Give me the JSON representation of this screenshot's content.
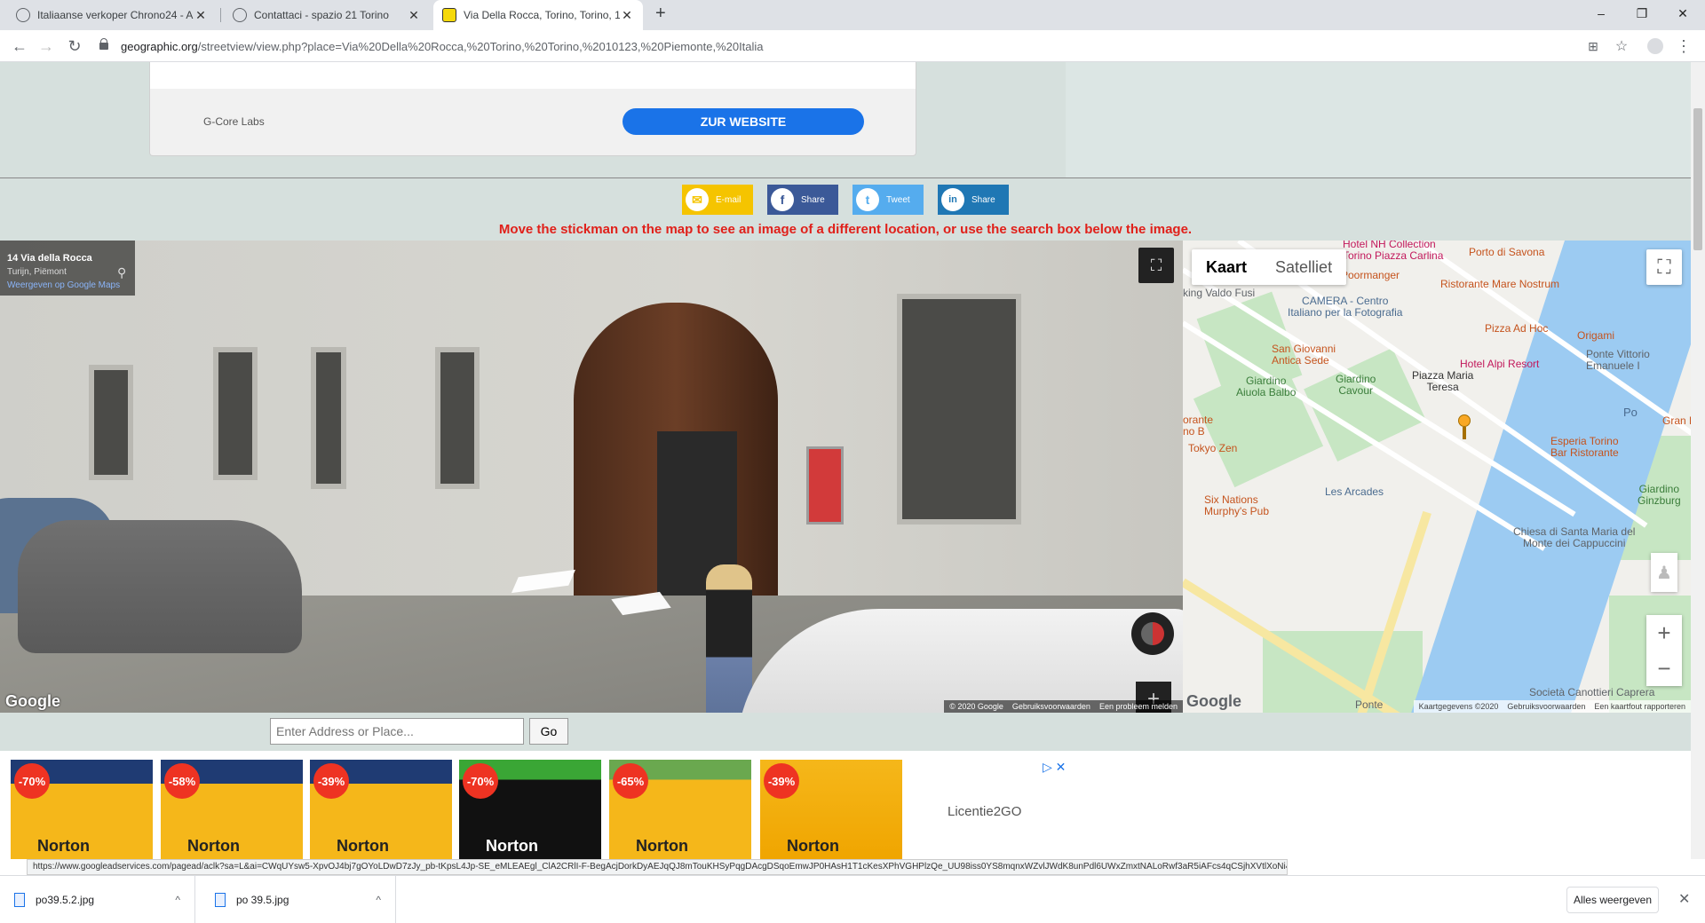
{
  "tabs": [
    {
      "title": "Italiaanse verkoper Chrono24 - A",
      "close": "✕"
    },
    {
      "title": "Contattaci - spazio 21 Torino",
      "close": "✕"
    },
    {
      "title": "Via Della Rocca, Torino, Torino, 10",
      "close": "✕"
    }
  ],
  "window_controls": {
    "minimize": "–",
    "restore": "❐",
    "close": "✕"
  },
  "new_tab": "+",
  "address": {
    "host": "geographic.org",
    "path": "/streetview/view.php?place=Via%20Della%20Rocca,%20Torino,%20Torino,%2010123,%20Piemonte,%20Italia"
  },
  "top_ad": {
    "advertiser": "G-Core Labs",
    "cta": "ZUR WEBSITE"
  },
  "share_buttons": [
    {
      "label": "E-mail",
      "color": "#f5c400",
      "glyph": "✉"
    },
    {
      "label": "Share",
      "color": "#3b5998",
      "glyph": "f"
    },
    {
      "label": "Tweet",
      "color": "#55acee",
      "glyph": "t"
    },
    {
      "label": "Share",
      "color": "#1f77b4",
      "glyph": "in"
    }
  ],
  "instruction": "Move the stickman on the map to see an image of a different location, or use the search box below the image.",
  "streetview": {
    "address": "14 Via della Rocca",
    "city": "Turijn, Piëmont",
    "maps_link": "Weergeven op Google Maps",
    "logo": "Google",
    "footer": [
      "© 2020 Google",
      "Gebruiksvoorwaarden",
      "Een probleem melden"
    ],
    "fullscreen": "⛶",
    "zoom_in": "+",
    "zoom_out": "−"
  },
  "map": {
    "tab_map": "Kaart",
    "tab_satellite": "Satelliet",
    "fullscreen": "⛶",
    "zoom_in": "+",
    "zoom_out": "−",
    "pegman": "♟",
    "logo": "Google",
    "footer": [
      "Kaartgegevens ©2020",
      "Gebruiksvoorwaarden",
      "Een kaartfout rapporteren"
    ],
    "labels": {
      "nh": "Hotel NH Collection\nTorino Piazza Carlina",
      "savona": "Porto di Savona",
      "poormanger": "Poormanger",
      "ristorante": "Ristorante Mare Nostrum",
      "valdo": "king Valdo Fusi",
      "camera": "CAMERA - Centro\nItaliano per la Fotografia",
      "pizza": "Pizza Ad Hoc",
      "origami": "Origami",
      "sangiovanni": "San Giovanni\nAntica Sede",
      "vittorio": "Ponte Vittorio\nEmanuele I",
      "alpi": "Hotel Alpi Resort",
      "aiuola": "Giardino\nAiuola Balbo",
      "cavour": "Giardino\nCavour",
      "teresa": "Piazza Maria\nTeresa",
      "po": "Po",
      "granbe": "Gran B",
      "orante": "orante\nno B",
      "tokyo": "Tokyo Zen",
      "esperia": "Esperia Torino\nBar Ristorante",
      "arcades": "Les Arcades",
      "ginzburg": "Giardino\nGinzburg",
      "sixnations": "Six Nations\nMurphy's Pub",
      "chiesa": "Chiesa di Santa Maria del\nMonte dei Cappuccini",
      "ponte": "Ponte",
      "canottieri": "Società Canottieri Caprera"
    }
  },
  "search": {
    "placeholder": "Enter Address or Place...",
    "button": "Go"
  },
  "bottom_ad": {
    "products": [
      {
        "discount": "-70%",
        "brand": "Norton"
      },
      {
        "discount": "-58%",
        "brand": "Norton"
      },
      {
        "discount": "-39%",
        "brand": "Norton"
      },
      {
        "discount": "-70%",
        "brand": "Norton"
      },
      {
        "discount": "-65%",
        "brand": "Norton"
      },
      {
        "discount": "-39%",
        "brand": "Norton"
      }
    ],
    "advertiser": "Licentie2GO",
    "adchoices": "▷ ✕"
  },
  "status_url": "https://www.googleadservices.com/pagead/aclk?sa=L&ai=CWqUYsw5-XpvOJ4bj7gOYoLDwD7zJy_pb-tKpsL4Jp-SE_eMLEAEgl_ClA2CRlI-F-BegAcjDorkDyAEJqQJ8mTouKHSyPqgDAcgDSqoEmwJP0HAsH1T1cKesXPhVGHPlzQe_UU98iss0YS8mqnxWZvlJWdK8unPdl6UWxZmxtNALoRwf3aR5iAFcs4qCSjhXVtlXoNi4hwuiki11-mpt5r3kvYrLM0VpH0k68efvLVTjUryi6...",
  "downloads": [
    {
      "name": "po39.5.2.jpg",
      "chev": "^"
    },
    {
      "name": "po 39.5.jpg",
      "chev": "^"
    }
  ],
  "show_all": "Alles weergeven",
  "close_downloads": "✕"
}
